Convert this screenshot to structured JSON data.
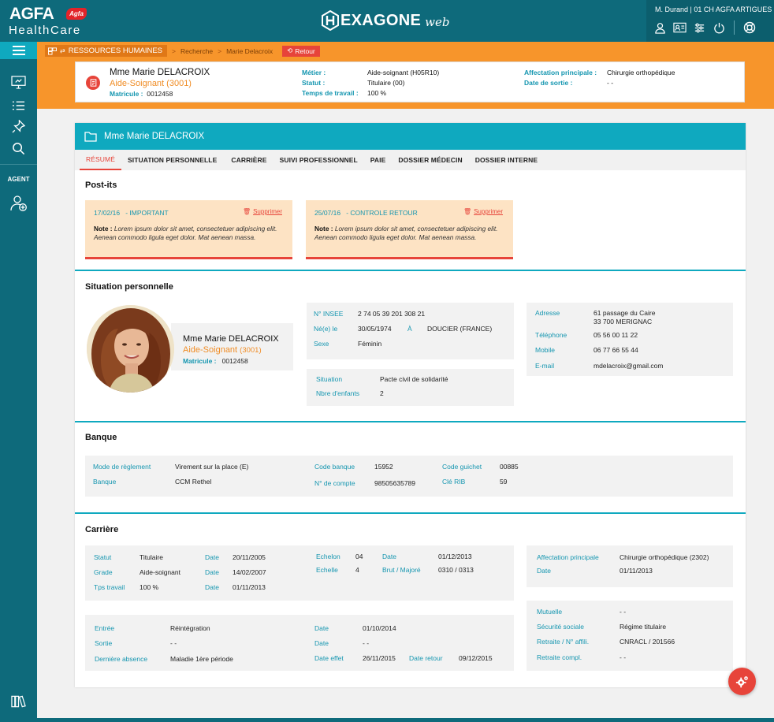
{
  "brand": {
    "agfa": "AGFA",
    "agfa_mark": "Agfa",
    "healthcare": "HealthCare",
    "hexagone": "EXAGONE",
    "web": "web"
  },
  "user": {
    "label": "M. Durand | 01 CH AGFA ARTIGUES"
  },
  "sidebar": {
    "agent_label": "AGENT"
  },
  "breadcrumb": {
    "section": "RESSOURCES HUMAINES",
    "items": [
      "Recherche",
      "Marie Delacroix"
    ],
    "back": "Retour"
  },
  "agent_header": {
    "name": "Mme Marie DELACROIX",
    "role": "Aide-Soignant",
    "role_code": "(3001)",
    "matricule_label": "Matricule :",
    "matricule": "0012458",
    "metier_label": "Métier :",
    "metier": "Aide-soignant (H05R10)",
    "statut_label": "Statut :",
    "statut": "Titulaire (00)",
    "temps_label": "Temps de travail :",
    "temps": "100 %",
    "affectation_label": "Affectation principale :",
    "affectation": "Chirurgie orthopédique",
    "sortie_label": "Date de sortie :",
    "sortie": "- -"
  },
  "card": {
    "title": "Mme Marie DELACROIX"
  },
  "tabs": [
    "RÉSUMÉ",
    "SITUATION PERSONNELLE",
    "CARRIÈRE",
    "SUIVI PROFESSIONNEL",
    "PAIE",
    "DOSSIER MÉDECIN",
    "DOSSIER INTERNE"
  ],
  "postits": {
    "title": "Post-its",
    "items": [
      {
        "date": "17/02/16",
        "tag": "-  IMPORTANT",
        "delete": "Supprimer",
        "note_label": "Note :",
        "note": "Lorem ipsum dolor sit amet, consectetuer adipiscing elit. Aenean commodo ligula eget dolor.  Mat aenean massa."
      },
      {
        "date": "25/07/16",
        "tag": "-  CONTROLE RETOUR",
        "delete": "Supprimer",
        "note_label": "Note :",
        "note": "Lorem ipsum dolor sit amet, consectetuer adipiscing elit. Aenean commodo ligula eget dolor.  Mat aenean massa."
      }
    ]
  },
  "situation": {
    "title": "Situation personnelle",
    "name": "Mme Marie DELACROIX",
    "role": "Aide-Soignant",
    "role_code": "(3001)",
    "matricule_label": "Matricule :",
    "matricule": "0012458",
    "insee_label": "N° INSEE",
    "insee": "2 74 05 39 201 308 21",
    "ne_label": "Né(e) le",
    "ne": "30/05/1974",
    "a_label": "À",
    "a": "DOUCIER (FRANCE)",
    "sexe_label": "Sexe",
    "sexe": "Féminin",
    "sit_label": "Situation",
    "sit": "Pacte civil de solidarité",
    "enfants_label": "Nbre d'enfants",
    "enfants": "2",
    "adresse_label": "Adresse",
    "adresse1": "61 passage du Caire",
    "adresse2": "33 700 MERIGNAC",
    "tel_label": "Téléphone",
    "tel": "05 56 00 11 22",
    "mobile_label": "Mobile",
    "mobile": "06 77 66 55 44",
    "email_label": "E-mail",
    "email": "mdelacroix@gmail.com"
  },
  "banque": {
    "title": "Banque",
    "mode_label": "Mode de règlement",
    "mode": "Virement sur la place (E)",
    "banque_label": "Banque",
    "banque": "CCM Rethel",
    "code_banque_label": "Code banque",
    "code_banque": "15952",
    "compte_label": "N° de compte",
    "compte": "98505635789",
    "guichet_label": "Code guichet",
    "guichet": "00885",
    "rib_label": "Clé RIB",
    "rib": "59"
  },
  "carriere": {
    "title": "Carrière",
    "statut_label": "Statut",
    "statut": "Titulaire",
    "date_label": "Date",
    "statut_date": "20/11/2005",
    "grade_label": "Grade",
    "grade": "Aide-soignant",
    "grade_date": "14/02/2007",
    "tps_label": "Tps travail",
    "tps": "100 %",
    "tps_date": "01/11/2013",
    "echelon_label": "Echelon",
    "echelon": "04",
    "echelon_date": "01/12/2013",
    "echelle_label": "Echelle",
    "echelle": "4",
    "brut_label": "Brut / Majoré",
    "brut": "0310 / 0313",
    "aff_label": "Affectation principale",
    "aff": "Chirurgie orthopédique (2302)",
    "aff_date": "01/11/2013",
    "entree_label": "Entrée",
    "entree": "Réintégration",
    "entree_date": "01/10/2014",
    "sortie_label": "Sortie",
    "sortie": "- -",
    "sortie_date": "- -",
    "absence_label": "Dernière absence",
    "absence": "Maladie 1ère période",
    "effet_label": "Date effet",
    "effet": "26/11/2015",
    "retour_label": "Date retour",
    "retour": "09/12/2015",
    "mutuelle_label": "Mutuelle",
    "mutuelle": "- -",
    "secu_label": "Sécurité sociale",
    "secu": "Régime titulaire",
    "retraite_label": "Retraite / N° affili.",
    "retraite": "CNRACL / 201566",
    "compl_label": "Retraite compl.",
    "compl": "- -"
  },
  "colors": {
    "teal_dark": "#0e6a7b",
    "teal": "#0fa9bf",
    "orange": "#f7952b",
    "red": "#e7443a",
    "label": "#1596b0"
  }
}
